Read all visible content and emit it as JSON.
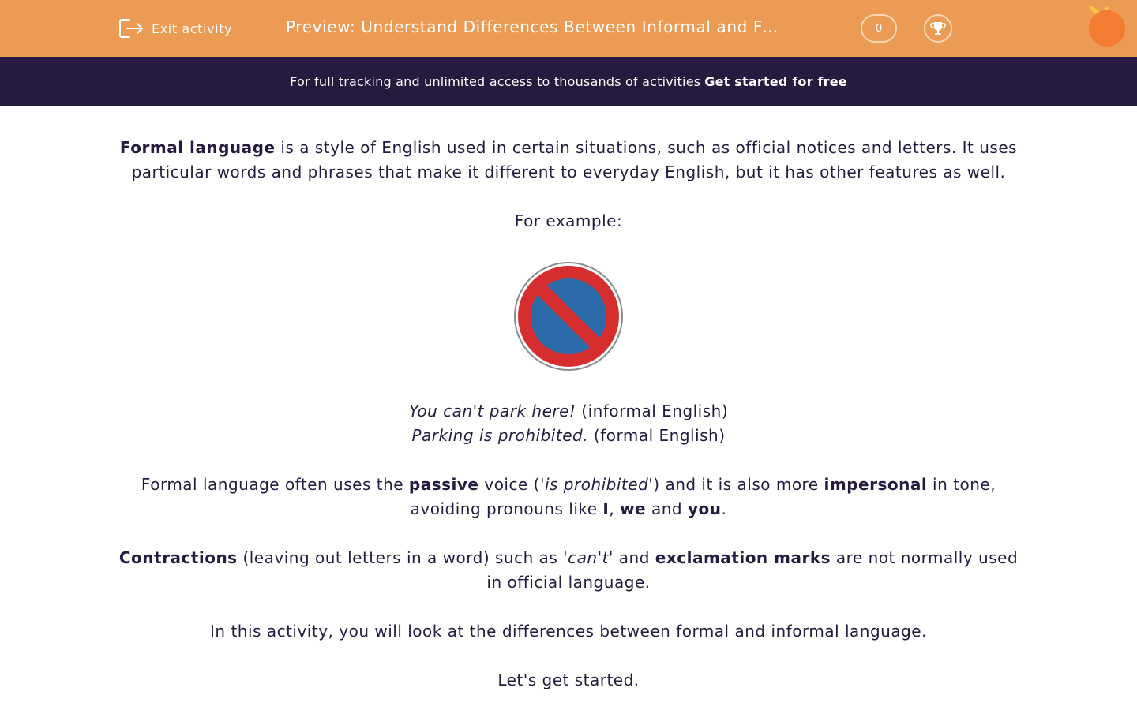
{
  "header": {
    "exit_label": "Exit activity",
    "title": "Preview: Understand Differences Between Informal and Fo…",
    "score": "0",
    "background_color": "#eb9b54"
  },
  "banner": {
    "text": "For full tracking and unlimited access to thousands of activities",
    "cta": "Get started for free",
    "background_color": "#251b3f"
  },
  "content": {
    "intro": {
      "term": "Formal language",
      "rest": " is a style of English used in certain situations, such as official notices and letters. It uses particular words and phrases that make it different to everyday English, but it has other features as well."
    },
    "for_example": "For example:",
    "sign_image": "no-parking-sign-icon",
    "example_informal": {
      "quote": "You can't park here!",
      "label": " (informal English)"
    },
    "example_formal": {
      "quote": "Parking is prohibited.",
      "label": " (formal English)"
    },
    "passive_para": {
      "t1": "Formal language often uses the ",
      "b1": "passive",
      "t2": " voice ('",
      "i1": "is prohibited",
      "t3": "') and it is also more ",
      "b2": "impersonal",
      "t4": " in tone, avoiding pronouns like ",
      "b3": "I",
      "t5": ", ",
      "b4": "we",
      "t6": " and ",
      "b5": "you",
      "t7": "."
    },
    "contractions_para": {
      "b1": "Contractions",
      "t1": " (leaving out letters in a word) such as '",
      "i1": "can't",
      "t2": "' and ",
      "b2": "exclamation marks",
      "t3": " are not normally used in official language."
    },
    "activity_line": "In this activity, you will look at the differences between formal and informal language.",
    "start_line": "Let's get started."
  }
}
